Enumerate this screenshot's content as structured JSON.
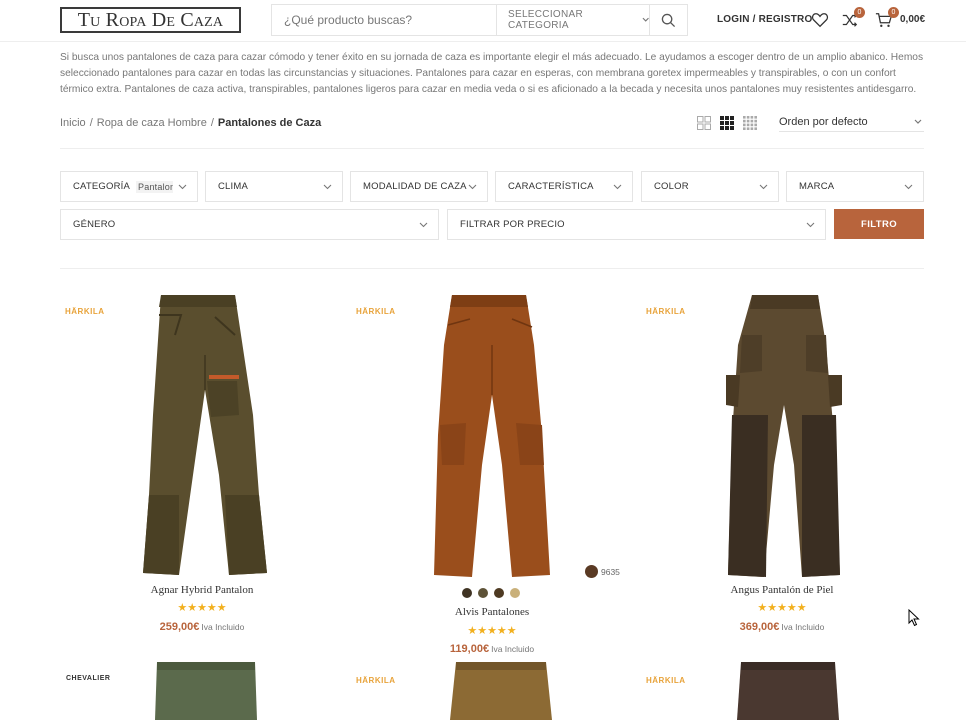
{
  "header": {
    "logo": "Tu Ropa De Caza",
    "search_placeholder": "¿Qué producto buscas?",
    "category_select": "SELECCIONAR CATEGORIA",
    "login": "LOGIN / REGISTRO",
    "compare_count": "0",
    "cart_count": "0",
    "cart_total": "0,00€"
  },
  "description": "Si busca unos pantalones de caza para cazar cómodo y tener éxito en su jornada de caza es importante elegir el más adecuado. Le ayudamos a escoger dentro de un amplio abanico. Hemos seleccionado pantalones para cazar en todas las circunstancias y situaciones. Pantalones para cazar en esperas, con membrana goretex impermeables y transpirables, o con un confort térmico extra. Pantalones de caza activa, transpirables, pantalones ligeros para cazar en media veda o si es aficionado a la becada y necesita unos pantalones muy resistentes antidesgarro.",
  "breadcrumb": {
    "home": "Inicio",
    "sep1": "/",
    "parent": "Ropa de caza Hombre",
    "sep2": "/",
    "current": "Pantalones de Caza"
  },
  "sort": "Orden por defecto",
  "filters": {
    "categoria": "CATEGORÍA",
    "categoria_value": "Pantalones",
    "clima": "CLIMA",
    "modalidad": "MODALIDAD DE CAZA",
    "caracteristica": "CARACTERÍSTICA",
    "color": "COLOR",
    "marca": "MARCA",
    "genero": "GÉNERO",
    "precio": "FILTRAR POR PRECIO",
    "button": "FILTRO"
  },
  "products": [
    {
      "brand": "HÄRKILA",
      "name": "Agnar Hybrid Pantalon",
      "stars": "★★★★★",
      "price": "259,00€",
      "iva": "Iva Incluido"
    },
    {
      "brand": "HÄRKILA",
      "name": "Alvis Pantalones",
      "stars": "★★★★★",
      "price": "119,00€",
      "iva": "Iva Incluido",
      "sku": "9635",
      "swatches": [
        "#3f3323",
        "#5d5237",
        "#4e3a22",
        "#c9b07a"
      ]
    },
    {
      "brand": "HÄRKILA",
      "name": "Angus Pantalón de Piel",
      "stars": "★★★★★",
      "price": "369,00€",
      "iva": "Iva Incluido"
    },
    {
      "brand": "CHEVALIER"
    },
    {
      "brand": "HÄRKILA"
    },
    {
      "brand": "HÄRKILA"
    }
  ],
  "colors": {
    "accent": "#b8643c",
    "star": "#f2b01e",
    "brand": "#e8a33a"
  }
}
